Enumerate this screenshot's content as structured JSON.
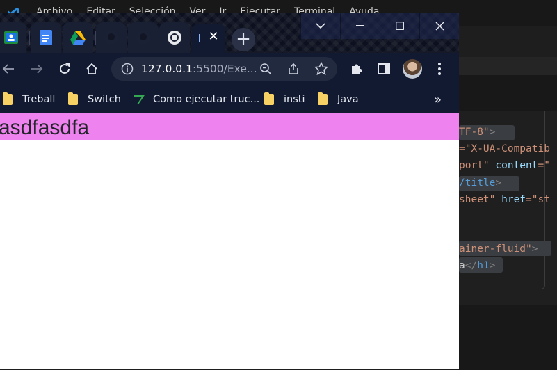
{
  "vscode": {
    "menu": [
      "Archivo",
      "Editar",
      "Selección",
      "Ver",
      "Ir",
      "Ejecutar",
      "Terminal",
      "Ayuda"
    ],
    "code_lines": [
      {
        "parts": [
          {
            "t": "TF-8\"",
            "c": "str"
          },
          {
            "t": ">",
            "c": "punc"
          }
        ]
      },
      {
        "parts": [
          {
            "t": "=\"X-UA-Compatib",
            "c": "str"
          }
        ]
      },
      {
        "parts": [
          {
            "t": "port\"",
            "c": "str"
          },
          {
            "t": " content",
            "c": "attr"
          },
          {
            "t": "=\"",
            "c": "str"
          }
        ]
      },
      {
        "parts": [
          {
            "t": "/title",
            "c": "tag"
          },
          {
            "t": ">",
            "c": "punc"
          }
        ]
      },
      {
        "parts": [
          {
            "t": "sheet\"",
            "c": "str"
          },
          {
            "t": " href",
            "c": "attr"
          },
          {
            "t": "=\"st",
            "c": "str"
          }
        ]
      },
      {
        "parts": [
          {
            "t": "ainer-fluid\"",
            "c": "str"
          },
          {
            "t": ">",
            "c": "punc"
          }
        ]
      },
      {
        "parts": [
          {
            "t": "a",
            "c": "plain"
          },
          {
            "t": "</",
            "c": "punc"
          },
          {
            "t": "h1",
            "c": "tag"
          },
          {
            "t": ">",
            "c": "punc"
          }
        ]
      }
    ]
  },
  "chrome": {
    "url_host": "127.0.0.1",
    "url_rest": ":5500/Exe...",
    "new_tab_label": "+",
    "bookmarks": [
      {
        "label": "Treball",
        "icon": "folder-icon"
      },
      {
        "label": "Switch",
        "icon": "folder-icon"
      },
      {
        "label": "Como ejecutar truc...",
        "icon": "link-icon"
      },
      {
        "label": "insti",
        "icon": "folder-icon"
      },
      {
        "label": "Java",
        "icon": "folder-icon"
      }
    ],
    "more_bookmarks": "»"
  },
  "page": {
    "heading": "asdfasdfa",
    "heading_bg": "#ee82ee"
  }
}
